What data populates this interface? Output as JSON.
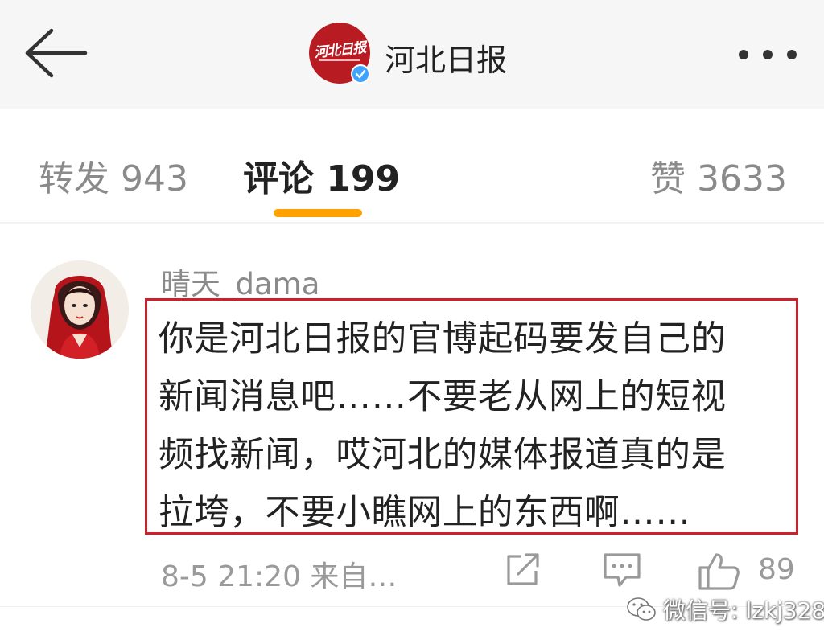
{
  "header": {
    "title": "河北日报",
    "logo_text": "河北日报"
  },
  "tabs": [
    {
      "label": "转发 943"
    },
    {
      "label": "评论 199"
    },
    {
      "label": "赞 3633"
    }
  ],
  "comment": {
    "username": "晴天_dama",
    "lines": [
      "你是河北日报的官博起码要发自己的",
      "新闻消息吧……不要老从网上的短视",
      "频找新闻，哎河北的媒体报道真的是",
      "拉垮，不要小瞧网上的东西啊……"
    ],
    "meta": "8-5 21:20 来自…",
    "like_count": "89"
  },
  "watermark": {
    "text": "微信号: lzkj328"
  },
  "colors": {
    "accent_indicator": "#ffa200",
    "highlight_border": "#cf1f2a",
    "logo_bg": "#b81c22",
    "verified": "#3ea2ff"
  },
  "icons": [
    "back-arrow-icon",
    "verified-icon",
    "more-dots-icon",
    "share-icon",
    "comment-icon",
    "thumbs-up-icon",
    "wechat-icon"
  ]
}
